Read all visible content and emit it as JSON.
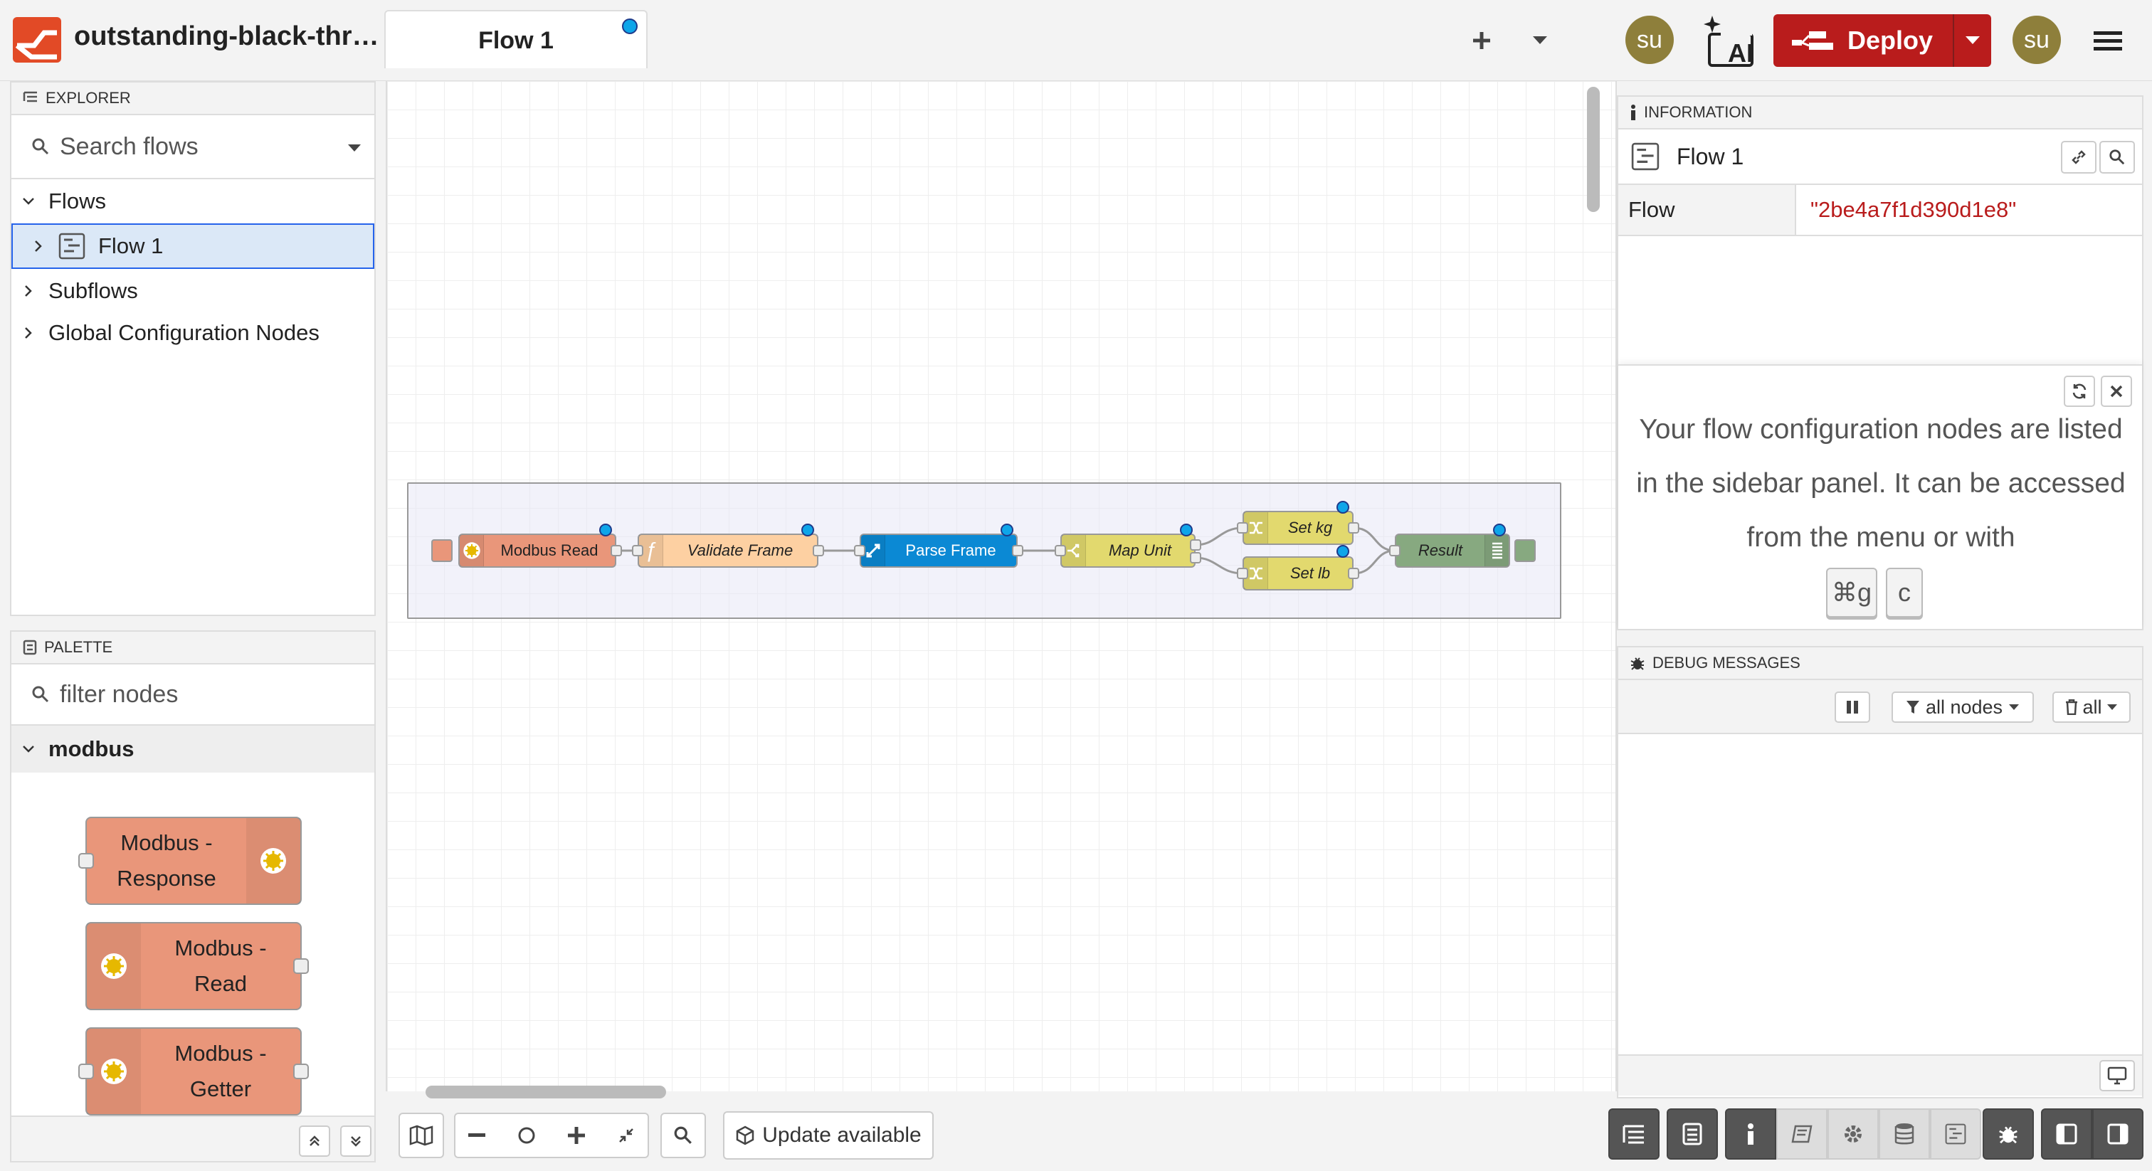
{
  "header": {
    "project_title": "outstanding-black-thro...",
    "active_tab": "Flow 1",
    "user_initials": "su",
    "ai_label": "AI",
    "deploy_label": "Deploy"
  },
  "explorer": {
    "title": "EXPLORER",
    "search_placeholder": "Search flows",
    "tree": {
      "flows": "Flows",
      "flow1": "Flow 1",
      "subflows": "Subflows",
      "global": "Global Configuration Nodes"
    }
  },
  "palette": {
    "title": "PALETTE",
    "filter_placeholder": "filter nodes",
    "category": "modbus",
    "nodes": {
      "response_l1": "Modbus -",
      "response_l2": "Response",
      "read_l1": "Modbus -",
      "read_l2": "Read",
      "getter_l1": "Modbus -",
      "getter_l2": "Getter"
    }
  },
  "canvas": {
    "nodes": {
      "modbus_read": "Modbus Read",
      "validate": "Validate Frame",
      "parse": "Parse Frame",
      "map": "Map Unit",
      "set_kg": "Set kg",
      "set_lb": "Set lb",
      "result": "Result"
    },
    "colors": {
      "modbus": "#e9967a",
      "function": "#fdd0a2",
      "parse": "#0b89d4",
      "switch": "#e2d96e",
      "debug": "#87a980"
    },
    "toolbar": {
      "update_label": "Update available"
    }
  },
  "info": {
    "title": "INFORMATION",
    "flow_name": "Flow 1",
    "prop_key": "Flow",
    "prop_value": "\"2be4a7f1d390d1e8\"",
    "tip_text": "Your flow configuration nodes are listed in the sidebar panel. It can be accessed from the menu or with",
    "kbd1": "⌘g",
    "kbd2": "c"
  },
  "debug": {
    "title": "DEBUG MESSAGES",
    "filter_label": "all nodes",
    "clear_label": "all"
  }
}
